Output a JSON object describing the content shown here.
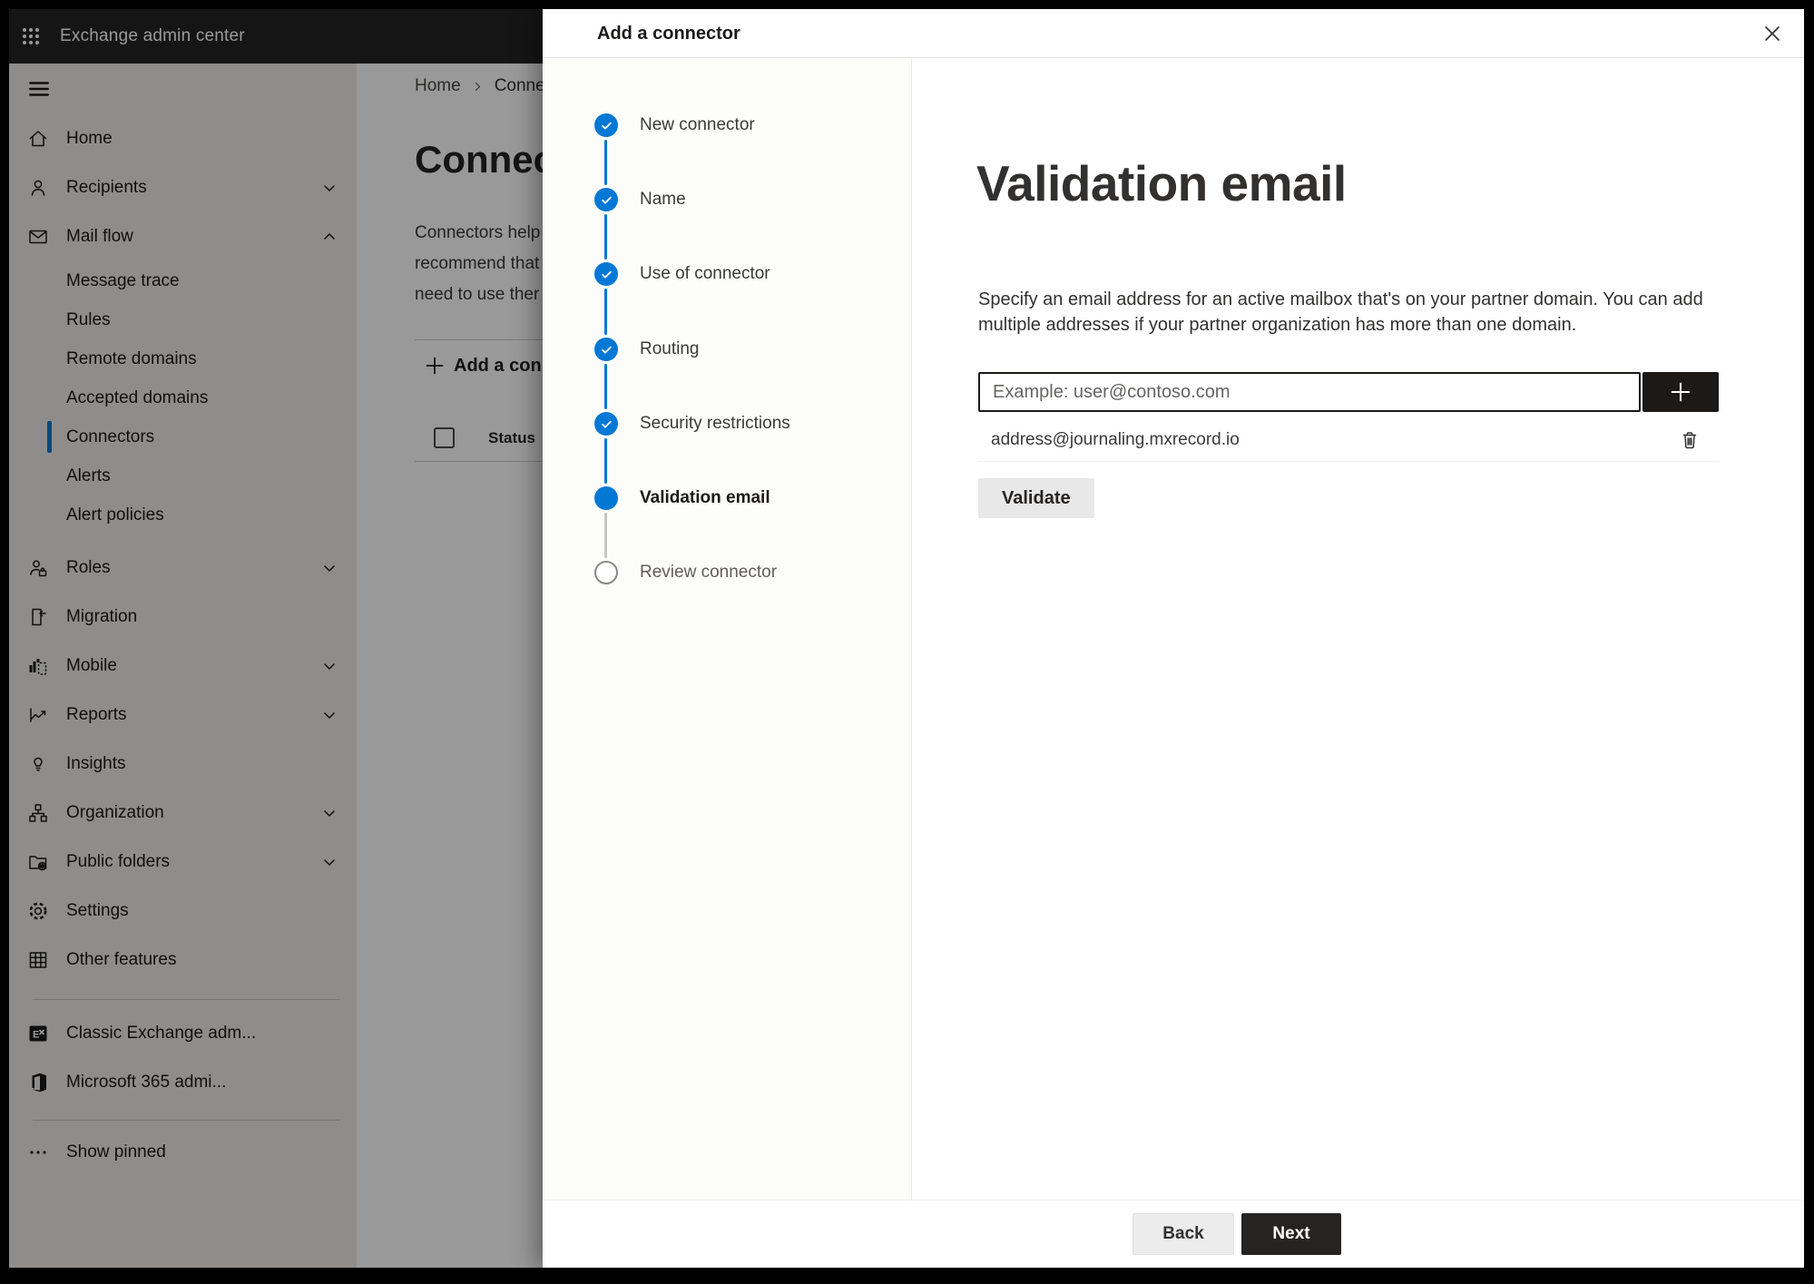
{
  "app": {
    "title": "Exchange admin center"
  },
  "background": {
    "breadcrumb": {
      "home": "Home",
      "current": "Conne"
    },
    "page_title": "Connect",
    "description_lines": [
      "Connectors help",
      "recommend that",
      "need to use ther"
    ],
    "add_button_label": "Add a conn",
    "table": {
      "status_header": "Status"
    }
  },
  "sidebar": {
    "items": [
      {
        "label": "Home"
      },
      {
        "label": "Recipients"
      },
      {
        "label": "Mail flow"
      },
      {
        "label": "Message trace"
      },
      {
        "label": "Rules"
      },
      {
        "label": "Remote domains"
      },
      {
        "label": "Accepted domains"
      },
      {
        "label": "Connectors",
        "selected": true
      },
      {
        "label": "Alerts"
      },
      {
        "label": "Alert policies"
      },
      {
        "label": "Roles"
      },
      {
        "label": "Migration"
      },
      {
        "label": "Mobile"
      },
      {
        "label": "Reports"
      },
      {
        "label": "Insights"
      },
      {
        "label": "Organization"
      },
      {
        "label": "Public folders"
      },
      {
        "label": "Settings"
      },
      {
        "label": "Other features"
      },
      {
        "label": "Classic Exchange adm..."
      },
      {
        "label": "Microsoft 365 admi..."
      },
      {
        "label": "Show pinned"
      }
    ]
  },
  "modal": {
    "title": "Add a connector",
    "steps": [
      {
        "label": "New connector",
        "state": "completed"
      },
      {
        "label": "Name",
        "state": "completed"
      },
      {
        "label": "Use of connector",
        "state": "completed"
      },
      {
        "label": "Routing",
        "state": "completed"
      },
      {
        "label": "Security restrictions",
        "state": "completed"
      },
      {
        "label": "Validation email",
        "state": "current"
      },
      {
        "label": "Review connector",
        "state": "upcoming"
      }
    ],
    "content": {
      "heading": "Validation email",
      "description_lines": [
        "Specify an email address for an active mailbox that's on your partner domain. You can add",
        "multiple addresses if your partner organization has more than one domain."
      ],
      "input_placeholder": "Example: user@contoso.com",
      "addresses": [
        "address@journaling.mxrecord.io"
      ],
      "validate_label": "Validate"
    },
    "footer": {
      "back_label": "Back",
      "next_label": "Next"
    }
  },
  "icons": {
    "app_launcher": "waffle-grid",
    "nav_toggle": "hamburger",
    "close": "x-mark",
    "step_done": "check-circle",
    "add": "plus",
    "delete": "trash-can",
    "breadcrumb_separator": "chevron-right"
  },
  "colors": {
    "accent": "#0078d4",
    "topbar_bg": "#252423",
    "dark_button_bg": "#1b1a19",
    "sidebar_bg": "#edebe9",
    "overlay": "rgba(0,0,0,0.40)"
  }
}
